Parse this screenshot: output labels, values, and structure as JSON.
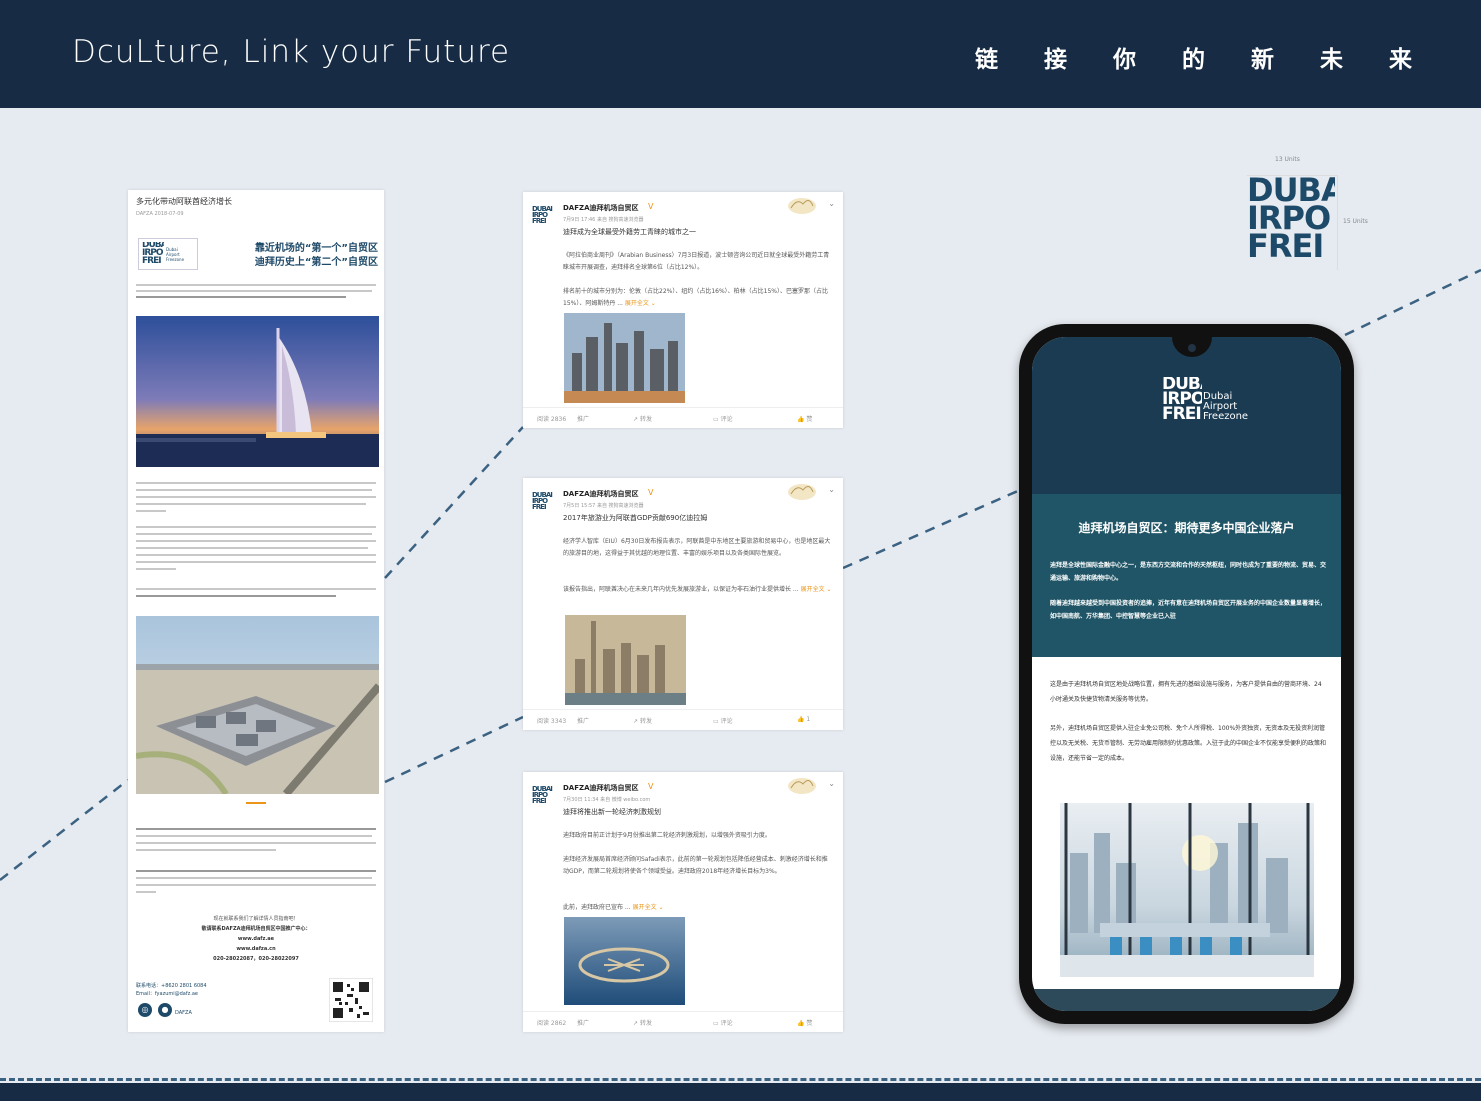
{
  "header": {
    "brand": "DcuLture, Link your Future",
    "slogan": "链接你的新未来"
  },
  "logo": {
    "units_top": "13 Units",
    "units_side": "15 Units",
    "mark_lines": [
      "DUBAI",
      "IRPO",
      "FREI"
    ]
  },
  "article": {
    "title": "多元化带动阿联酋经济增长",
    "meta": "DAFZA  2018-07-09",
    "headline_1": "靠近机场的“第一个”自贸区",
    "headline_2": "迪拜历史上“第二个”自贸区",
    "logo_words": [
      "Dubai",
      "Airport",
      "Freezone"
    ],
    "contact_intro": "现在就联系我们了解详情人员指南吧！",
    "contact_org": "敬请联系DAFZA迪拜机场自贸区中国推广中心：",
    "site_1": "www.dafz.ae",
    "site_2": "www.dafza.cn",
    "phone": "020-28022087，020-28022097",
    "tel": "联系电话：+8620 2801 6084",
    "email": "Email：fyazumi@dafz.ae",
    "footer_label": "DAFZA"
  },
  "weibo": [
    {
      "name": "DAFZA迪拜机场自贸区",
      "meta": "7月9日 17:46 来自 搜狗高速浏览器",
      "lead": "迪拜成为全球最受外籍劳工青睐的城市之一",
      "p1": "《阿拉伯商业周刊》（Arabian Business）7月3日报道，波士顿咨询公司近日就全球最受外籍劳工青睐城市开展调查，迪拜排名全球第6位（占比12%）。",
      "p2": "排名前十的城市分别为：伦敦（占比22%）、纽约（占比16%）、柏林（占比15%）、巴塞罗那（占比15%）、阿姆斯特丹 ...",
      "more": "展开全文 ⌄",
      "stats": [
        "阅读 2836",
        "推广",
        "转发",
        "评论",
        "赞"
      ]
    },
    {
      "name": "DAFZA迪拜机场自贸区",
      "meta": "7月5日 15:57 来自 搜狗高速浏览器",
      "lead": "2017年旅游业为阿联酋GDP贡献690亿迪拉姆",
      "p1": "经济学人智库（EIU）6月30日发布报告表示，阿联酋是中东地区主要旅游和贸易中心，也是地区最大的旅游目的地，这得益于其优越的地理位置、丰富的娱乐项目以及各类国际性展览。",
      "p2": "该报告指出，阿联酋决心在未来几年内优先发展旅游业，以保证为非石油行业提供增长 ...",
      "more": "展开全文 ⌄",
      "stats": [
        "阅读 3343",
        "推广",
        "转发",
        "评论",
        "1"
      ]
    },
    {
      "name": "DAFZA迪拜机场自贸区",
      "meta": "7月30日 11:34 来自 微博 weibo.com",
      "lead": "迪拜将推出新一轮经济刺激规划",
      "p1": "迪拜政府目前正计划于9月份推出第二轮经济刺激规划，以增强外资吸引力度。",
      "p2": "迪拜经济发展局首席经济顾问Safadi表示，此前的第一轮规划包括降低经营成本、刺激经济增长和推动GDP，而第二轮规划将使各个领域受益。迪拜政府2018年经济增长目标为3%。",
      "p3": "此前，迪拜政府已宣布 ...",
      "more": "展开全文 ⌄",
      "stats": [
        "阅读 2862",
        "推广",
        "转发",
        "评论",
        "赞"
      ]
    }
  ],
  "phone": {
    "logo_words": [
      "Dubai",
      "Airport",
      "Freezone"
    ],
    "heading": "迪拜机场自贸区：期待更多中国企业落户",
    "p1": "迪拜是全球性国际金融中心之一，是东西方交流和合作的天然枢纽，同时也成为了重要的物流、贸易、交通运输、旅游和购物中心。",
    "p2": "随着迪拜越来越受到中国投资者的追捧，近年有意在迪拜机场自贸区开展业务的中国企业数量显著增长，如中国南航、万华集团、中控智慧等企业已入驻",
    "p3": "这是由于迪拜机场自贸区地处战略位置，拥有先进的基础设施与服务，为客户提供自由的营商环境、24小时通关及快捷货物清关服务等优势。",
    "p4": "另外，迪拜机场自贸区提供入驻企业免公司税、免个人所得税、100%外资独资，无资本及无投资利润管控以及无关税、无货币管制、无劳动雇用限制的优惠政策。入驻于此的中国企业不仅能享受便利的政策和设施，还能节省一定的成本。"
  }
}
